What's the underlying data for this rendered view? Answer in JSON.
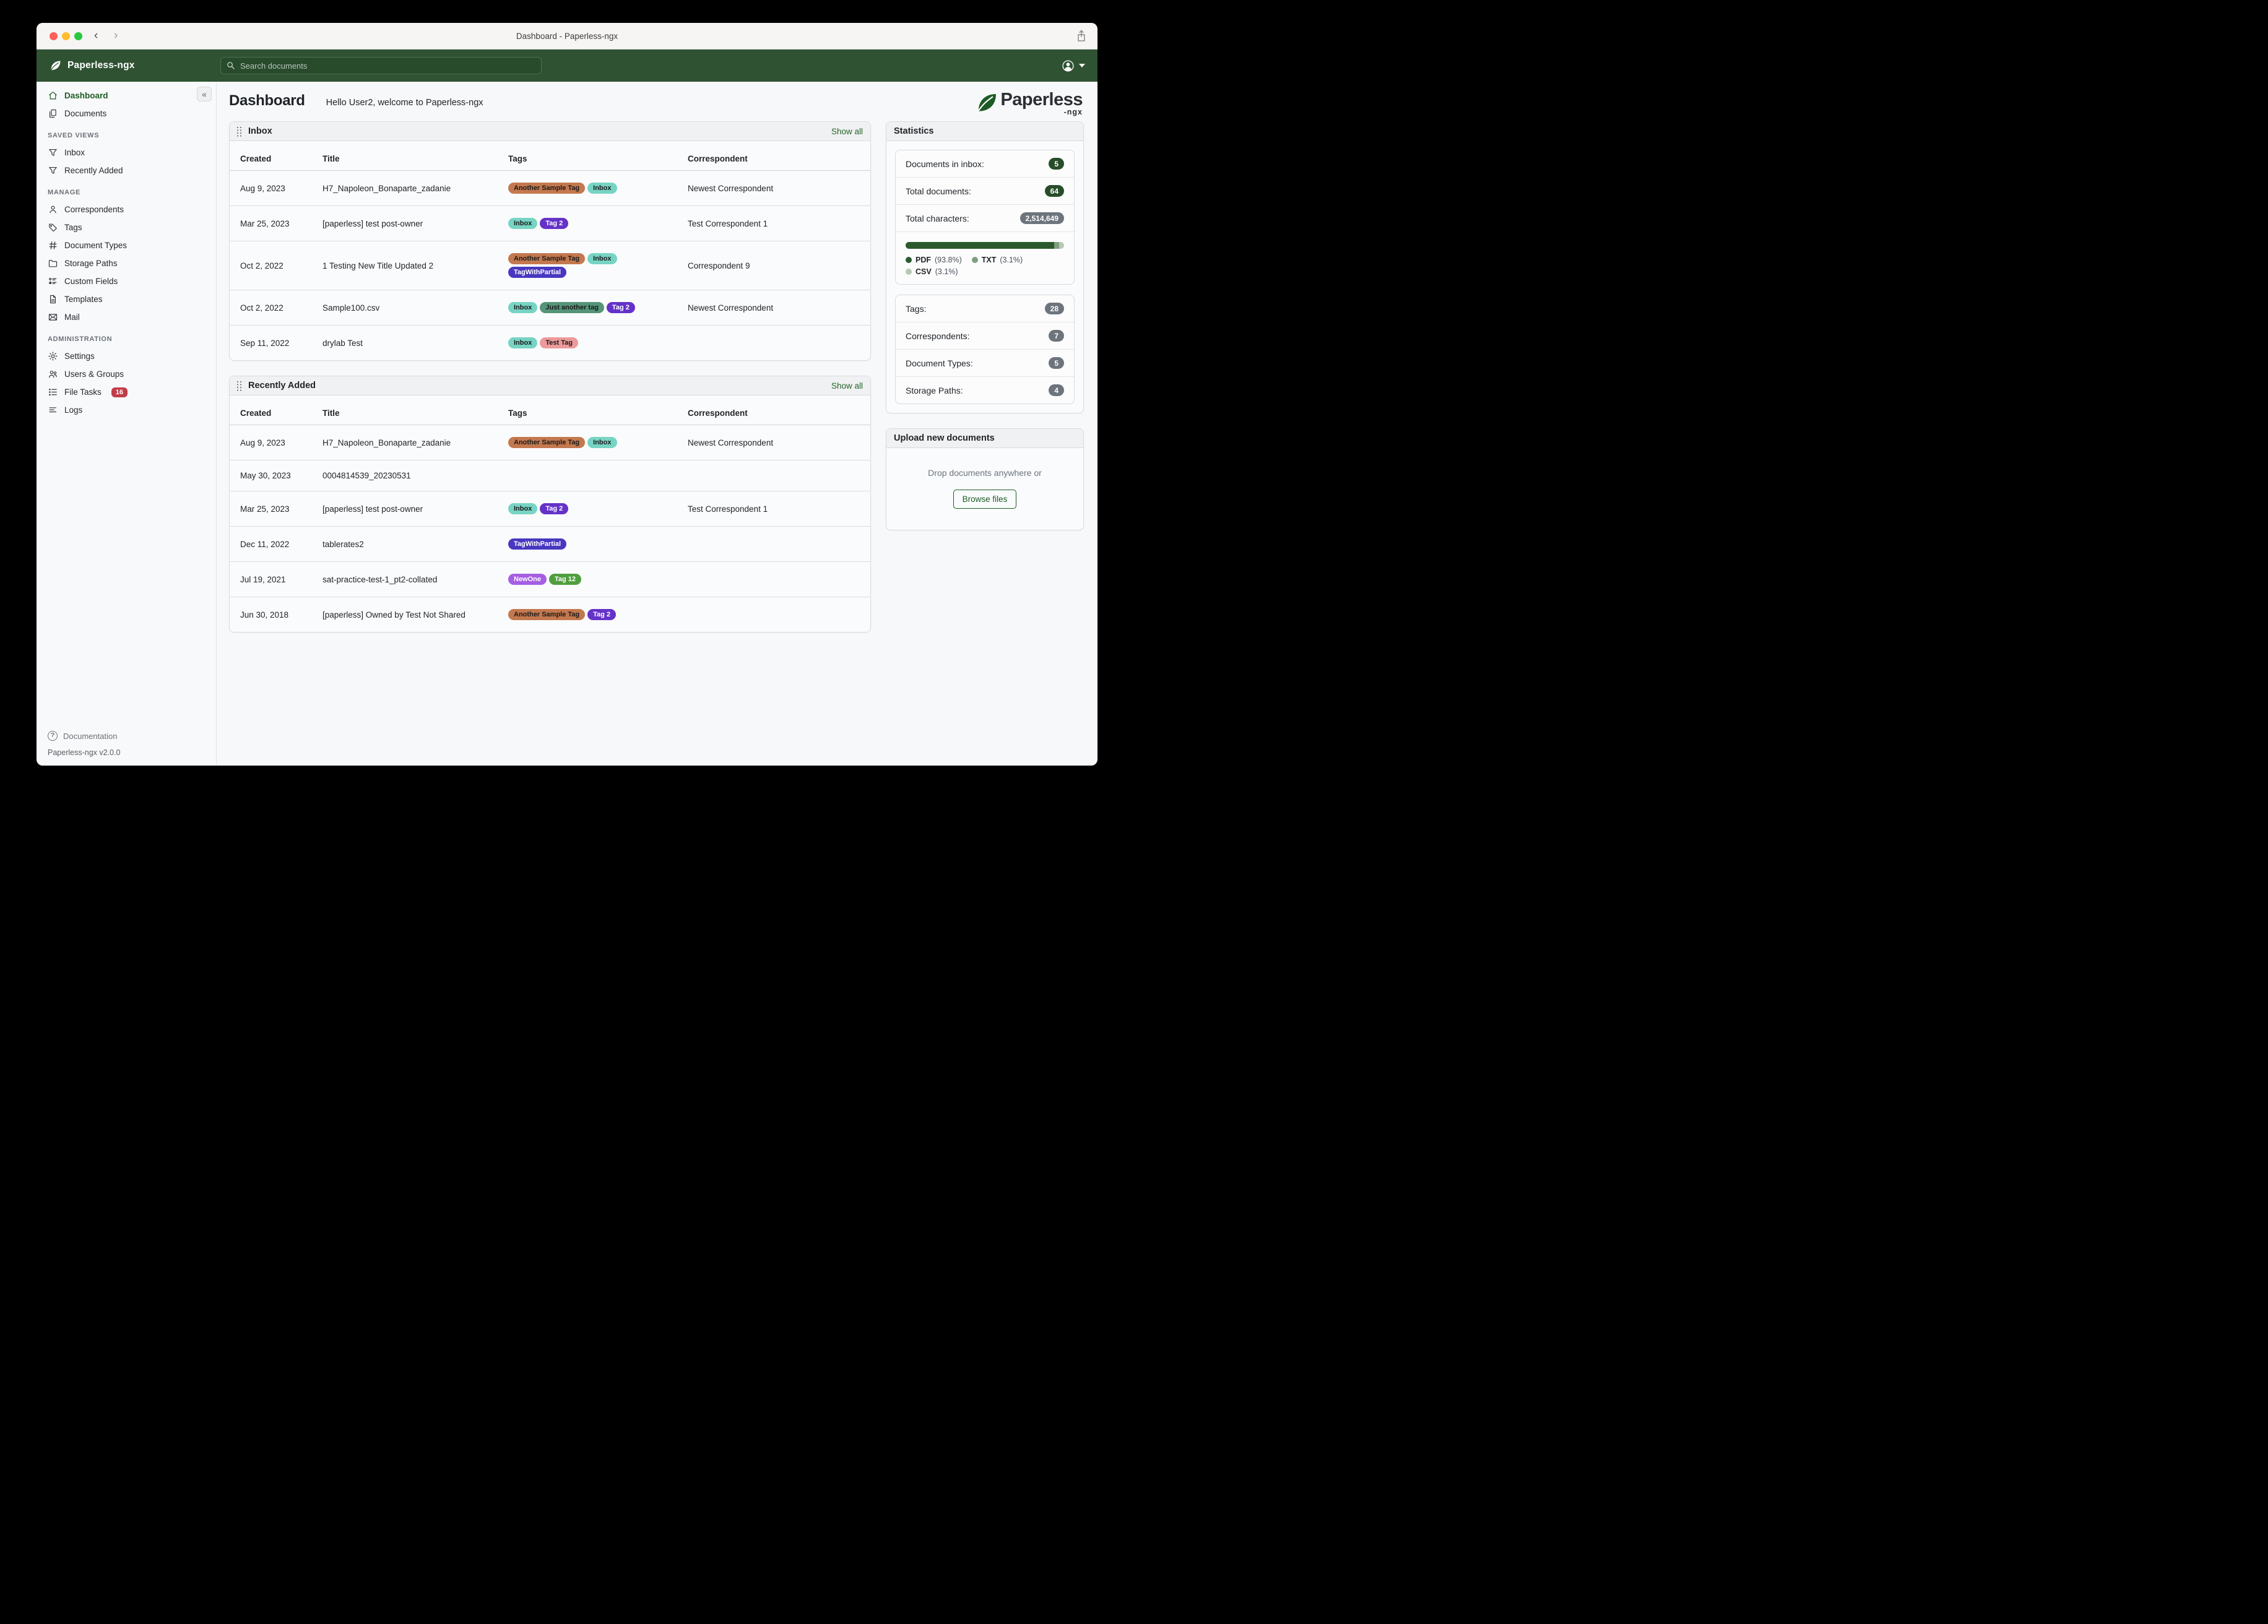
{
  "window": {
    "titlebar_title": "Dashboard - Paperless-ngx"
  },
  "navbar": {
    "brand": "Paperless-ngx",
    "search_placeholder": "Search documents",
    "colors": {
      "bar": "#2f5233"
    }
  },
  "sidebar": {
    "collapse_glyph": "«",
    "sections": [
      {
        "label": null,
        "items": [
          {
            "icon": "home",
            "label": "Dashboard",
            "active": true
          },
          {
            "icon": "documents",
            "label": "Documents"
          }
        ]
      },
      {
        "label": "SAVED VIEWS",
        "items": [
          {
            "icon": "filter",
            "label": "Inbox"
          },
          {
            "icon": "filter",
            "label": "Recently Added"
          }
        ]
      },
      {
        "label": "MANAGE",
        "items": [
          {
            "icon": "person",
            "label": "Correspondents"
          },
          {
            "icon": "tag",
            "label": "Tags"
          },
          {
            "icon": "hash",
            "label": "Document Types"
          },
          {
            "icon": "folder",
            "label": "Storage Paths"
          },
          {
            "icon": "fields",
            "label": "Custom Fields"
          },
          {
            "icon": "file",
            "label": "Templates"
          },
          {
            "icon": "mail",
            "label": "Mail"
          }
        ]
      },
      {
        "label": "ADMINISTRATION",
        "items": [
          {
            "icon": "gear",
            "label": "Settings"
          },
          {
            "icon": "users",
            "label": "Users & Groups"
          },
          {
            "icon": "tasks",
            "label": "File Tasks",
            "badge": "16"
          },
          {
            "icon": "logs",
            "label": "Logs"
          }
        ]
      }
    ],
    "documentation_label": "Documentation",
    "version": "Paperless-ngx v2.0.0"
  },
  "header": {
    "title": "Dashboard",
    "greeting": "Hello User2, welcome to Paperless-ngx"
  },
  "logo": {
    "word": "Paperless",
    "suffix": "-ngx"
  },
  "tag_styles": {
    "Another Sample Tag": {
      "bg": "#c4784e",
      "fg": "#1a1a1a"
    },
    "Inbox": {
      "bg": "#77d4c4",
      "fg": "#1a1a1a"
    },
    "Tag 2": {
      "bg": "#6432c8",
      "fg": "#ffffff"
    },
    "TagWithPartial": {
      "bg": "#4838c0",
      "fg": "#ffffff"
    },
    "Just another tag": {
      "bg": "#559478",
      "fg": "#1a1a1a"
    },
    "Test Tag": {
      "bg": "#ec9a9b",
      "fg": "#1a1a1a"
    },
    "NewOne": {
      "bg": "#a55fe2",
      "fg": "#ffffff"
    },
    "Tag 12": {
      "bg": "#4f9f3e",
      "fg": "#ffffff"
    }
  },
  "panels": [
    {
      "id": "inbox",
      "title": "Inbox",
      "show_all": "Show all",
      "columns": [
        "Created",
        "Title",
        "Tags",
        "Correspondent"
      ],
      "rows": [
        {
          "created": "Aug 9, 2023",
          "title": "H7_Napoleon_Bonaparte_zadanie",
          "tags": [
            "Another Sample Tag",
            "Inbox"
          ],
          "correspondent": "Newest Correspondent"
        },
        {
          "created": "Mar 25, 2023",
          "title": "[paperless] test post-owner",
          "tags": [
            "Inbox",
            "Tag 2"
          ],
          "correspondent": "Test Correspondent 1"
        },
        {
          "created": "Oct 2, 2022",
          "title": "1 Testing New Title Updated 2",
          "tags": [
            "Another Sample Tag",
            "Inbox",
            "TagWithPartial"
          ],
          "correspondent": "Correspondent 9"
        },
        {
          "created": "Oct 2, 2022",
          "title": "Sample100.csv",
          "tags": [
            "Inbox",
            "Just another tag",
            "Tag 2"
          ],
          "correspondent": "Newest Correspondent"
        },
        {
          "created": "Sep 11, 2022",
          "title": "drylab Test",
          "tags": [
            "Inbox",
            "Test Tag"
          ],
          "correspondent": ""
        }
      ]
    },
    {
      "id": "recently-added",
      "title": "Recently Added",
      "show_all": "Show all",
      "columns": [
        "Created",
        "Title",
        "Tags",
        "Correspondent"
      ],
      "rows": [
        {
          "created": "Aug 9, 2023",
          "title": "H7_Napoleon_Bonaparte_zadanie",
          "tags": [
            "Another Sample Tag",
            "Inbox"
          ],
          "correspondent": "Newest Correspondent"
        },
        {
          "created": "May 30, 2023",
          "title": "0004814539_20230531",
          "tags": [],
          "correspondent": ""
        },
        {
          "created": "Mar 25, 2023",
          "title": "[paperless] test post-owner",
          "tags": [
            "Inbox",
            "Tag 2"
          ],
          "correspondent": "Test Correspondent 1"
        },
        {
          "created": "Dec 11, 2022",
          "title": "tablerates2",
          "tags": [
            "TagWithPartial"
          ],
          "correspondent": ""
        },
        {
          "created": "Jul 19, 2021",
          "title": "sat-practice-test-1_pt2-collated",
          "tags": [
            "NewOne",
            "Tag 12"
          ],
          "correspondent": ""
        },
        {
          "created": "Jun 30, 2018",
          "title": "[paperless] Owned by Test Not Shared",
          "tags": [
            "Another Sample Tag",
            "Tag 2"
          ],
          "correspondent": ""
        }
      ]
    }
  ],
  "statistics": {
    "title": "Statistics",
    "counts_primary": [
      {
        "label": "Documents in inbox:",
        "value": "5",
        "style": "green"
      },
      {
        "label": "Total documents:",
        "value": "64",
        "style": "green"
      },
      {
        "label": "Total characters:",
        "value": "2,514,649",
        "style": "gray"
      }
    ],
    "file_types": [
      {
        "name": "PDF",
        "pct_label": "(93.8%)",
        "pct": 93.8,
        "color": "#2c5a2e"
      },
      {
        "name": "TXT",
        "pct_label": "(3.1%)",
        "pct": 3.1,
        "color": "#7f9e80"
      },
      {
        "name": "CSV",
        "pct_label": "(3.1%)",
        "pct": 3.1,
        "color": "#b7c9b5"
      }
    ],
    "counts_secondary": [
      {
        "label": "Tags:",
        "value": "28",
        "style": "gray"
      },
      {
        "label": "Correspondents:",
        "value": "7",
        "style": "gray"
      },
      {
        "label": "Document Types:",
        "value": "5",
        "style": "gray"
      },
      {
        "label": "Storage Paths:",
        "value": "4",
        "style": "gray"
      }
    ]
  },
  "upload": {
    "title": "Upload new documents",
    "hint": "Drop documents anywhere or",
    "button_label": "Browse files"
  }
}
